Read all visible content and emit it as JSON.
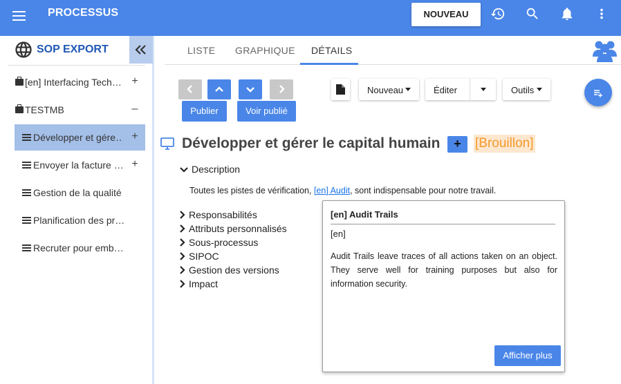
{
  "appbar": {
    "title": "PROCESSUS",
    "new_button": "NOUVEAU",
    "icons": [
      "menu-icon",
      "history-icon",
      "search-icon",
      "bell-icon",
      "more-vert-icon"
    ],
    "color": "#4a86e8"
  },
  "sidebar": {
    "header": "SOP EXPORT",
    "items": [
      {
        "label": "[en] Interfacing Tech…",
        "icon": "briefcase-icon",
        "action": "+"
      },
      {
        "label": "TESTMB",
        "icon": "briefcase-icon",
        "action": "–"
      },
      {
        "label": "Développer et gére…",
        "icon": "list-icon",
        "action": "+",
        "selected": true
      },
      {
        "label": "Envoyer la facture …",
        "icon": "list-icon",
        "action": "+"
      },
      {
        "label": "Gestion de la qualité",
        "icon": "list-icon",
        "action": ""
      },
      {
        "label": "Planification des pr…",
        "icon": "list-icon",
        "action": ""
      },
      {
        "label": "Recruter pour emb…",
        "icon": "list-icon",
        "action": ""
      }
    ]
  },
  "tabs": [
    {
      "label": "LISTE",
      "active": false
    },
    {
      "label": "GRAPHIQUE",
      "active": false
    },
    {
      "label": "DÉTAILS",
      "active": true
    }
  ],
  "toolbar": {
    "publish": "Publier",
    "view_published": "Voir publié",
    "nouveau": "Nouveau",
    "editer": "Éditer",
    "outils": "Outils"
  },
  "main": {
    "title": "Développer et gérer le capital humain",
    "plus": "+",
    "status": "[Brouillon]",
    "description_label": "Description",
    "description_before": "Toutes les pistes de vérification, ",
    "description_link": "[en] Audit",
    "description_after": ", sont indispensable pour notre travail.",
    "sections": [
      "Responsabilités",
      "Attributs personnalisés",
      "Sous-processus",
      "SIPOC",
      "Gestion des versions",
      "Impact"
    ]
  },
  "popover": {
    "title": "[en] Audit Trails",
    "lang": "[en]",
    "body": "Audit Trails leave traces of all actions taken on an object. They serve well for training purposes but also for information security.",
    "more_button": "Afficher plus"
  }
}
